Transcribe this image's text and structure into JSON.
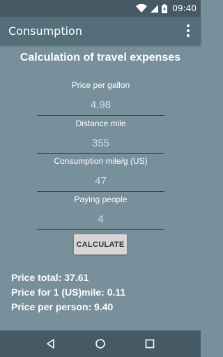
{
  "status_bar": {
    "time": "09:40",
    "icons": [
      "wifi-icon",
      "signal-icon",
      "battery-charging-icon"
    ]
  },
  "app_bar": {
    "title": "Consumption",
    "menu_icon": "overflow-menu-icon"
  },
  "main": {
    "heading": "Calculation of travel expenses",
    "fields": [
      {
        "label": "Price per gallon",
        "value": "4.98"
      },
      {
        "label": "Distance mile",
        "value": "355"
      },
      {
        "label": "Consumption mile/g (US)",
        "value": "47"
      },
      {
        "label": "Paying people",
        "value": "4"
      }
    ],
    "calculate_label": "CALCULATE",
    "results": {
      "price_total": "Price total: 37.61",
      "price_per_mile": "Price for 1 (US)mile: 0.11",
      "price_per_person": "Price per person: 9.40"
    }
  },
  "nav_bar": {
    "buttons": [
      "back-icon",
      "home-icon",
      "recents-icon"
    ]
  },
  "colors": {
    "background": "#78909c",
    "app_bar": "#546e7a",
    "status_bar": "#455a64",
    "input_text": "#b9e8e6"
  }
}
